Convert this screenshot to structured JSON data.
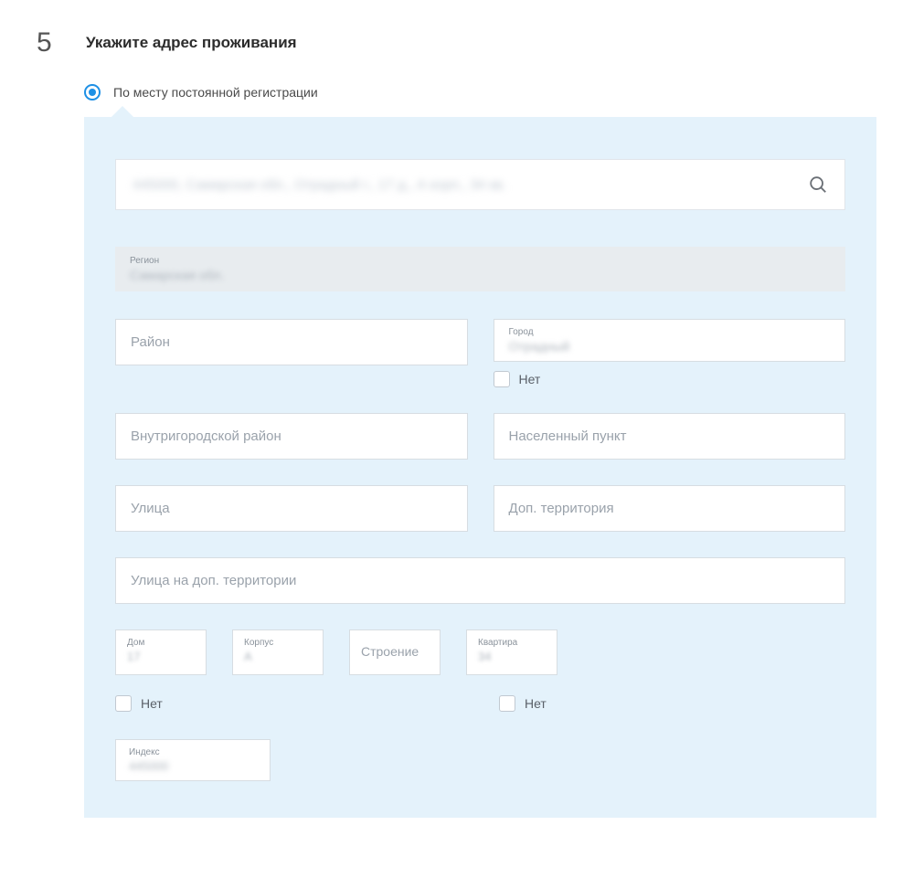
{
  "step": {
    "number": "5",
    "title": "Укажите адрес проживания"
  },
  "radio": {
    "label": "По месту постоянной регистрации"
  },
  "search": {
    "value": "445000, Самарская обл., Отрадный г., 17 д., А корп., 34 кв."
  },
  "region": {
    "label": "Регион",
    "value": "Самарская обл."
  },
  "district": {
    "placeholder": "Район"
  },
  "city": {
    "label": "Город",
    "value": "Отрадный",
    "no_label": "Нет"
  },
  "inner_district": {
    "placeholder": "Внутригородской район"
  },
  "settlement": {
    "placeholder": "Населенный пункт"
  },
  "street": {
    "placeholder": "Улица"
  },
  "add_territory": {
    "placeholder": "Доп. территория"
  },
  "street_on_territory": {
    "placeholder": "Улица на доп. территории"
  },
  "house": {
    "label": "Дом",
    "value": "17",
    "no_label": "Нет"
  },
  "building1": {
    "label": "Корпус",
    "value": "А"
  },
  "building2": {
    "placeholder": "Строение"
  },
  "flat": {
    "label": "Квартира",
    "value": "34",
    "no_label": "Нет"
  },
  "index": {
    "label": "Индекс",
    "value": "445000"
  }
}
